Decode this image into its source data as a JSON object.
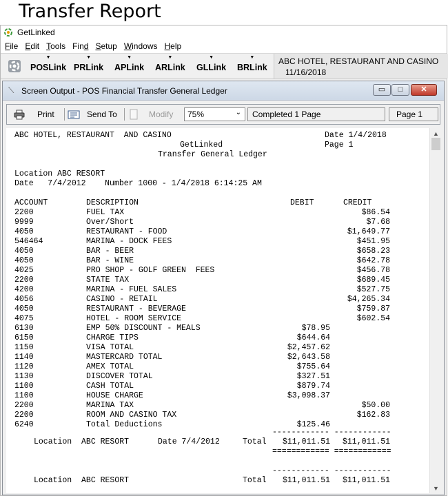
{
  "heading": "Transfer Report",
  "app": {
    "title": "GetLinked",
    "menu": [
      "File",
      "Edit",
      "Tools",
      "Find",
      "Setup",
      "Windows",
      "Help"
    ],
    "links": [
      "POSLink",
      "PRLink",
      "APLink",
      "ARLink",
      "GLLink",
      "BRLink"
    ],
    "hotel_name": "ABC HOTEL, RESTAURANT  AND CASINO",
    "date": "11/16/2018"
  },
  "window": {
    "title": "Screen Output - POS Financial Transfer General Ledger",
    "controls": {
      "minimize": "▭",
      "maximize": "□",
      "close": "✕"
    }
  },
  "toolbar": {
    "print": "Print",
    "send_to": "Send To",
    "modify": "Modify",
    "zoom": "75%",
    "status": "Completed 1 Page",
    "page": "Page 1"
  },
  "report": {
    "company": "ABC HOTEL, RESTAURANT  AND CASINO",
    "app_name": "GetLinked",
    "report_title": "Transfer General Ledger",
    "date_label": "Date 1/4/2018",
    "page_label": "Page 1",
    "location_line": "Location ABC RESORT",
    "date_line": "Date   7/4/2012    Number 1000 - 1/4/2018 6:14:25 AM",
    "columns": {
      "account": "ACCOUNT",
      "description": "DESCRIPTION",
      "debit": "DEBIT",
      "credit": "CREDIT"
    },
    "rows": [
      {
        "account": "2200",
        "description": "FUEL TAX",
        "debit": "",
        "credit": "$86.54"
      },
      {
        "account": "9999",
        "description": "Over/Short",
        "debit": "",
        "credit": "$7.68"
      },
      {
        "account": "4050",
        "description": "RESTAURANT - FOOD",
        "debit": "",
        "credit": "$1,649.77"
      },
      {
        "account": "546464",
        "description": "MARINA - DOCK FEES",
        "debit": "",
        "credit": "$451.95"
      },
      {
        "account": "4050",
        "description": "BAR - BEER",
        "debit": "",
        "credit": "$658.23"
      },
      {
        "account": "4050",
        "description": "BAR - WINE",
        "debit": "",
        "credit": "$642.78"
      },
      {
        "account": "4025",
        "description": "PRO SHOP - GOLF GREEN  FEES",
        "debit": "",
        "credit": "$456.78"
      },
      {
        "account": "2200",
        "description": "STATE TAX",
        "debit": "",
        "credit": "$689.45"
      },
      {
        "account": "4200",
        "description": "MARINA - FUEL SALES",
        "debit": "",
        "credit": "$527.75"
      },
      {
        "account": "4056",
        "description": "CASINO - RETAIL",
        "debit": "",
        "credit": "$4,265.34"
      },
      {
        "account": "4050",
        "description": "RESTAURANT - BEVERAGE",
        "debit": "",
        "credit": "$759.87"
      },
      {
        "account": "4075",
        "description": "HOTEL - ROOM SERVICE",
        "debit": "",
        "credit": "$602.54"
      },
      {
        "account": "6130",
        "description": "EMP 50% DISCOUNT - MEALS",
        "debit": "$78.95",
        "credit": ""
      },
      {
        "account": "6150",
        "description": "CHARGE TIPS",
        "debit": "$644.64",
        "credit": ""
      },
      {
        "account": "1150",
        "description": "VISA TOTAL",
        "debit": "$2,457.62",
        "credit": ""
      },
      {
        "account": "1140",
        "description": "MASTERCARD TOTAL",
        "debit": "$2,643.58",
        "credit": ""
      },
      {
        "account": "1120",
        "description": "AMEX TOTAL",
        "debit": "$755.64",
        "credit": ""
      },
      {
        "account": "1130",
        "description": "DISCOVER TOTAL",
        "debit": "$327.51",
        "credit": ""
      },
      {
        "account": "1100",
        "description": "CASH TOTAL",
        "debit": "$879.74",
        "credit": ""
      },
      {
        "account": "1100",
        "description": "HOUSE CHARGE",
        "debit": "$3,098.37",
        "credit": ""
      },
      {
        "account": "2200",
        "description": "MARINA TAX",
        "debit": "",
        "credit": "$50.00"
      },
      {
        "account": "2200",
        "description": "ROOM AND CASINO TAX",
        "debit": "",
        "credit": "$162.83"
      },
      {
        "account": "6240",
        "description": "Total Deductions",
        "debit": "$125.46",
        "credit": ""
      }
    ],
    "dash_line": "------------ ------------",
    "double_line": "============ ============",
    "totals1": {
      "location": "Location  ABC RESORT",
      "date": "Date 7/4/2012",
      "label": "Total",
      "debit": "$11,011.51",
      "credit": "$11,011.51"
    },
    "totals2": {
      "location": "Location  ABC RESORT",
      "label": "Total",
      "debit": "$11,011.51",
      "credit": "$11,011.51"
    }
  }
}
